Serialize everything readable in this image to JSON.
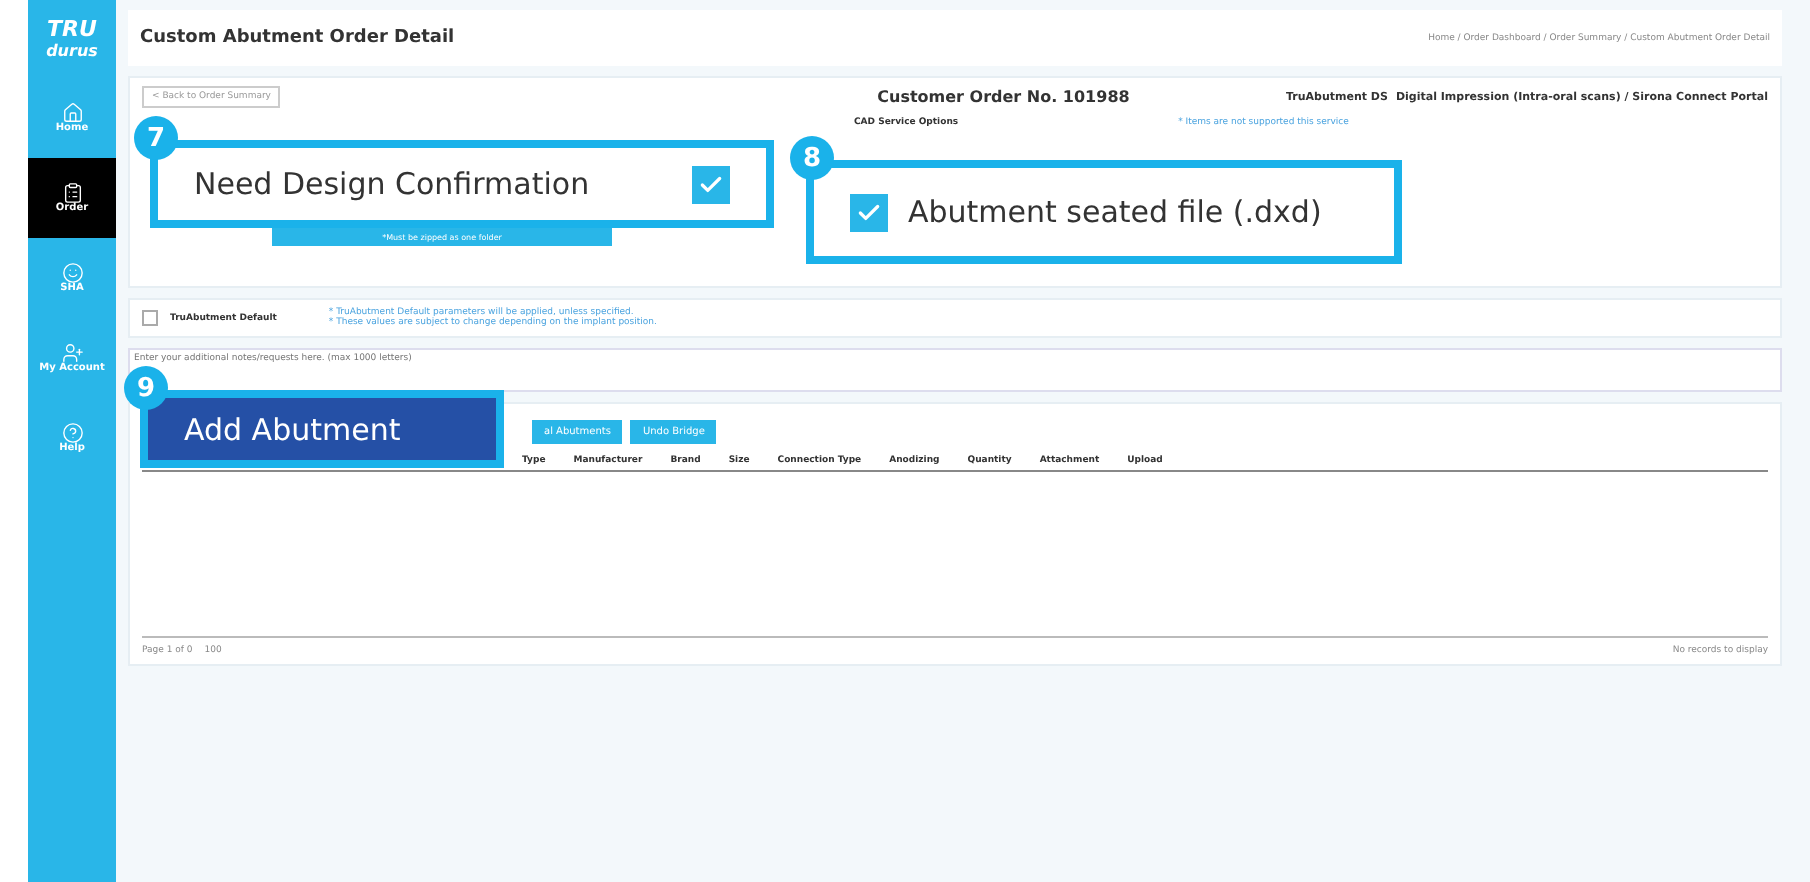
{
  "sidebar": {
    "logo_top": "TRU",
    "logo_bottom": "durus",
    "items": [
      {
        "label": "Home",
        "selected": false
      },
      {
        "label": "Order",
        "selected": true
      },
      {
        "label": "SHA",
        "selected": false
      },
      {
        "label": "My Account",
        "selected": false
      },
      {
        "label": "Help",
        "selected": false
      }
    ]
  },
  "header": {
    "title": "Custom Abutment Order Detail",
    "breadcrumb": "Home / Order Dashboard / Order Summary / Custom Abutment Order Detail"
  },
  "order": {
    "back_button": "< Back to Order Summary",
    "customer_order": "Customer Order No. 101988",
    "product": "TruAbutment DS",
    "path": "Digital Impression (Intra-oral scans) / Sirona Connect Portal",
    "upload_note": "*Must be zipped as one folder",
    "cad_title": "CAD Service Options",
    "cad_note": "* Items are not supported this service",
    "truabutment_default": {
      "label": "TruAbutment Default",
      "checked": false
    },
    "default_notes": [
      "* TruAbutment Default parameters will be applied, unless specified.",
      "* These values are subject to change depending on the implant position."
    ],
    "notes_placeholder": "Enter your additional notes/requests here. (max 1000 letters)"
  },
  "table": {
    "buttons": [
      "al Abutments",
      "Undo Bridge"
    ],
    "columns": [
      "Type",
      "Manufacturer",
      "Brand",
      "Size",
      "Connection Type",
      "Anodizing",
      "Quantity",
      "Attachment",
      "Upload"
    ],
    "pager": "Page 1 of 0",
    "page_size": "100",
    "empty": "No records to display"
  },
  "callouts": [
    {
      "number": "7",
      "kind": "checkbox",
      "label": "Need Design Confirmation",
      "checked": true
    },
    {
      "number": "8",
      "kind": "checkbox",
      "label": "Abutment seated file (.dxd)",
      "checked": true
    },
    {
      "number": "9",
      "kind": "button",
      "label": "Add Abutment"
    }
  ]
}
